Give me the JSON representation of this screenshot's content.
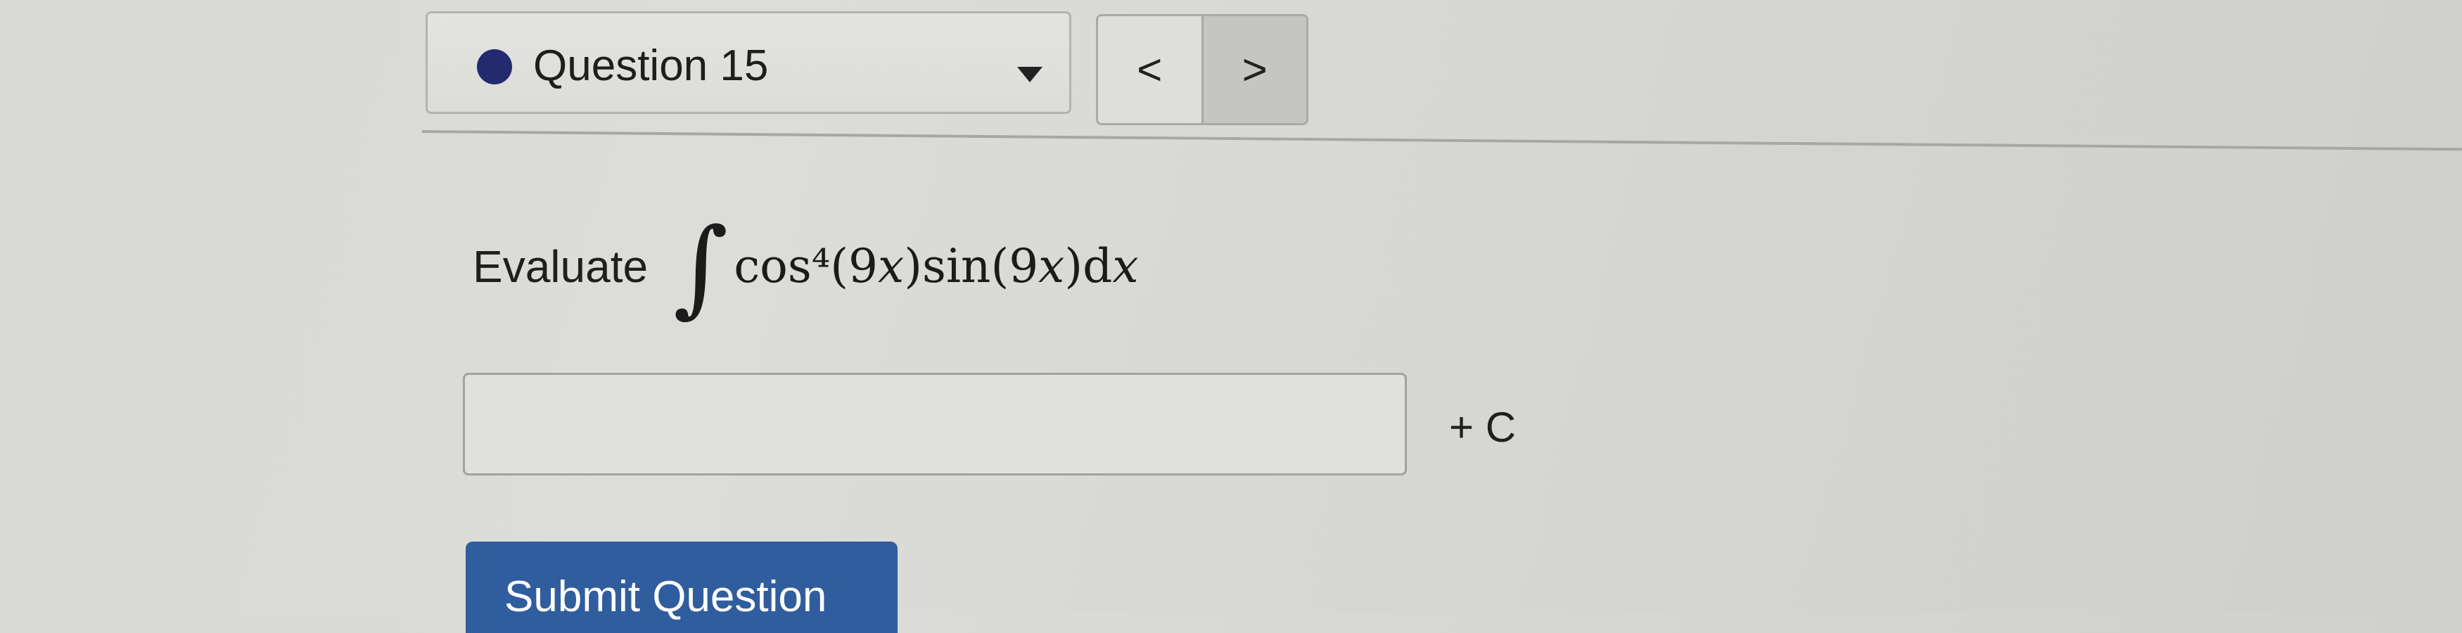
{
  "question_nav": {
    "title": "Question 15",
    "status_color": "#232a6e",
    "prev_label": "<",
    "next_label": ">"
  },
  "problem": {
    "label": "Evaluate",
    "integral_symbol": "∫",
    "expression": "cos⁴(9𝑥)sin(9𝑥)d𝑥"
  },
  "answer": {
    "value": "",
    "placeholder": "",
    "suffix": "+ C"
  },
  "submit": {
    "label": "Submit Question",
    "color": "#305d9d"
  }
}
